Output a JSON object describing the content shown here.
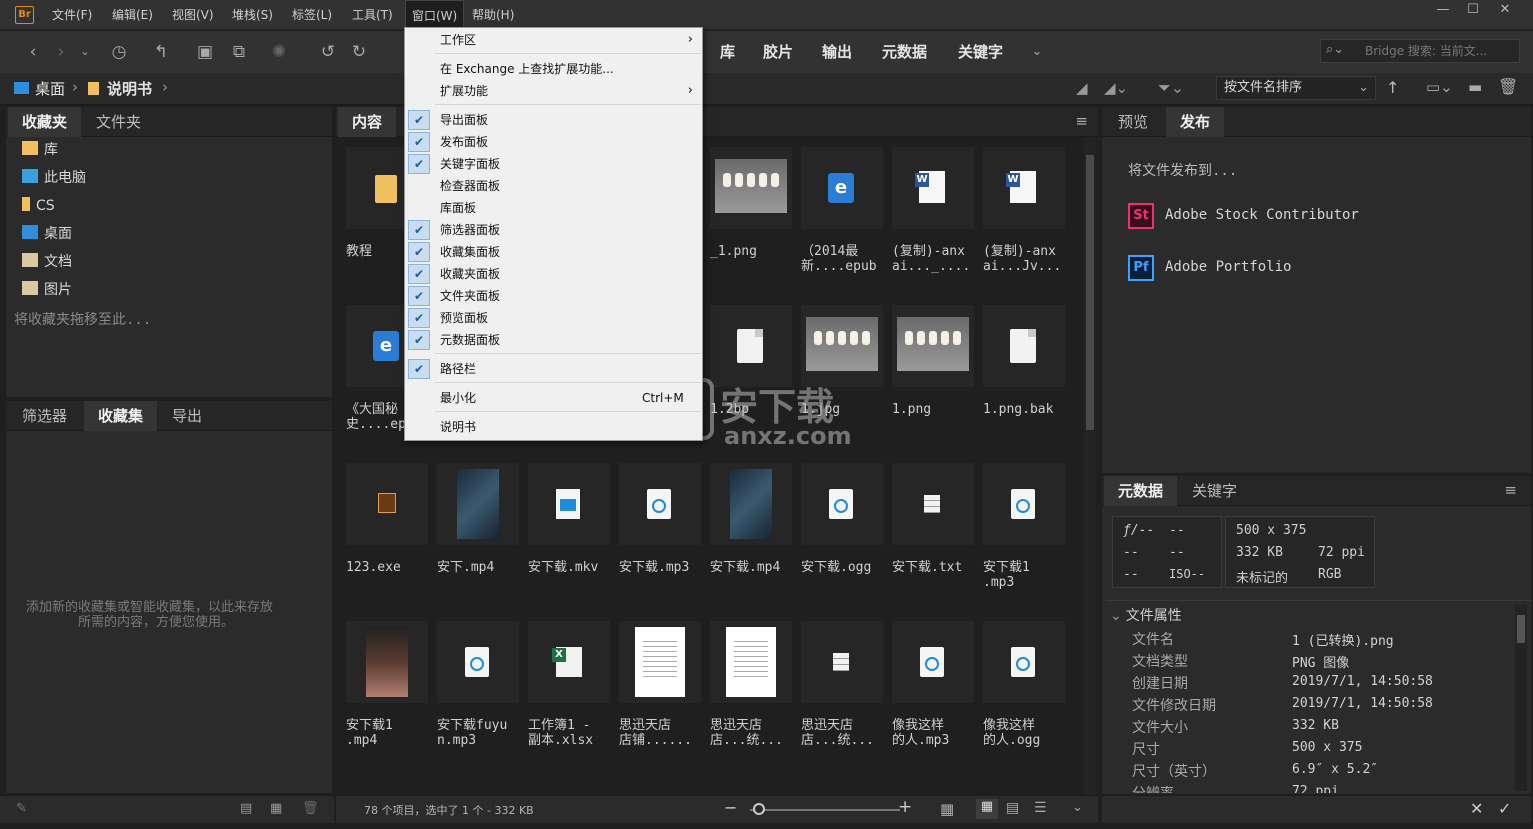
{
  "app": {
    "logo": "Br"
  },
  "menubar": {
    "items": [
      "文件(F)",
      "编辑(E)",
      "视图(V)",
      "堆栈(S)",
      "标签(L)",
      "工具(T)",
      "窗口(W)",
      "帮助(H)"
    ],
    "window_controls": [
      "—",
      "☐",
      "✕"
    ]
  },
  "workspaces": [
    "库",
    "胶片",
    "输出",
    "元数据",
    "关键字"
  ],
  "search": {
    "placeholder": "Bridge 搜索: 当前文..."
  },
  "breadcrumb": [
    "桌面",
    "说明书"
  ],
  "sort": {
    "label": "按文件名排序"
  },
  "left_top_panel": {
    "tabs": [
      "收藏夹",
      "文件夹"
    ],
    "items": [
      "库",
      "此电脑",
      "CS",
      "桌面",
      "文档",
      "图片"
    ],
    "hint": "将收藏夹拖移至此..."
  },
  "left_bottom_panel": {
    "tabs": [
      "筛选器",
      "收藏集",
      "导出"
    ],
    "hint_line1": "添加新的收藏集或智能收藏集，以此来存放",
    "hint_line2": "所需的内容，方便您使用。"
  },
  "content_panel": {
    "tab": "内容",
    "items": [
      {
        "label": "教程",
        "icon": "folder"
      },
      {
        "label": "",
        "icon": "hidden"
      },
      {
        "label": "",
        "icon": "hidden"
      },
      {
        "label": "",
        "icon": "hidden"
      },
      {
        "label": "_1.png",
        "icon": "dogs"
      },
      {
        "label": "（2014最\n新....epub",
        "icon": "edge"
      },
      {
        "label": "(复制)-anx\nai..._....",
        "icon": "word"
      },
      {
        "label": "(复制)-anx\nai...Jv...",
        "icon": "word"
      },
      {
        "label": "《大国秘\n史....ep",
        "icon": "edge"
      },
      {
        "label": "",
        "icon": "hidden"
      },
      {
        "label": "",
        "icon": "hidden"
      },
      {
        "label": "",
        "icon": "hidden"
      },
      {
        "label": "1.2bp",
        "icon": "doc"
      },
      {
        "label": "1.jpg",
        "icon": "dogs"
      },
      {
        "label": "1.png",
        "icon": "dogs"
      },
      {
        "label": "1.png.bak",
        "icon": "doc"
      },
      {
        "label": "123.exe",
        "icon": "exe"
      },
      {
        "label": "安下.mp4",
        "icon": "dark"
      },
      {
        "label": "安下载.mkv",
        "icon": "video"
      },
      {
        "label": "安下载.mp3",
        "icon": "media"
      },
      {
        "label": "安下载.mp4",
        "icon": "dark"
      },
      {
        "label": "安下载.ogg",
        "icon": "media"
      },
      {
        "label": "安下载.txt",
        "icon": "txt"
      },
      {
        "label": "安下载1\n.mp3",
        "icon": "media"
      },
      {
        "label": "安下载1\n.mp4",
        "icon": "portrait"
      },
      {
        "label": "安下载fuyu\nn.mp3",
        "icon": "media"
      },
      {
        "label": "工作簿1 -\n副本.xlsx",
        "icon": "xls"
      },
      {
        "label": "思迅天店\n店铺......",
        "icon": "page"
      },
      {
        "label": "思迅天店\n店...统...",
        "icon": "page"
      },
      {
        "label": "思迅天店\n店...统...",
        "icon": "txt"
      },
      {
        "label": "像我这样\n的人.mp3",
        "icon": "media"
      },
      {
        "label": "像我这样\n的人.ogg",
        "icon": "media"
      }
    ]
  },
  "status": {
    "text": "78 个项目，选中了 1 个 - 332 KB"
  },
  "right_top_panel": {
    "tabs": [
      "预览",
      "发布"
    ],
    "publish_title": "将文件发布到...",
    "targets": [
      {
        "badge": "St",
        "label": "Adobe Stock Contributor",
        "color": "#e8336b"
      },
      {
        "badge": "Pf",
        "label": "Adobe Portfolio",
        "color": "#3ea0ff"
      }
    ]
  },
  "metadata_panel": {
    "tabs": [
      "元数据",
      "关键字"
    ],
    "camera": {
      "f": "ƒ/--",
      "f2": "--",
      "a": "--",
      "b": "--",
      "c": "--",
      "iso": "ISO--"
    },
    "summary": {
      "dims": "500 x 375",
      "size": "332 KB",
      "ppi": "72 ppi",
      "label": "未标记的",
      "mode": "RGB"
    },
    "section": "文件属性",
    "props": [
      {
        "k": "文件名",
        "v": "1 (已转换).png"
      },
      {
        "k": "文档类型",
        "v": "PNG 图像"
      },
      {
        "k": "创建日期",
        "v": "2019/7/1, 14:50:58"
      },
      {
        "k": "文件修改日期",
        "v": "2019/7/1, 14:50:58"
      },
      {
        "k": "文件大小",
        "v": "332 KB"
      },
      {
        "k": "尺寸",
        "v": "500 x 375"
      },
      {
        "k": "尺寸（英寸）",
        "v": "6.9″ x 5.2″"
      },
      {
        "k": "分辨率",
        "v": "72 ppi"
      }
    ]
  },
  "window_menu": {
    "items": [
      {
        "label": "工作区",
        "check": false,
        "arrow": "›"
      },
      {
        "label": "在 Exchange 上查找扩展功能...",
        "check": false
      },
      {
        "label": "扩展功能",
        "check": false,
        "arrow": "›"
      },
      {
        "label": "导出面板",
        "check": true
      },
      {
        "label": "发布面板",
        "check": true
      },
      {
        "label": "关键字面板",
        "check": true
      },
      {
        "label": "检查器面板",
        "check": false
      },
      {
        "label": "库面板",
        "check": false
      },
      {
        "label": "筛选器面板",
        "check": true
      },
      {
        "label": "收藏集面板",
        "check": true
      },
      {
        "label": "收藏夹面板",
        "check": true
      },
      {
        "label": "文件夹面板",
        "check": true
      },
      {
        "label": "预览面板",
        "check": true
      },
      {
        "label": "元数据面板",
        "check": true
      },
      {
        "label": "路径栏",
        "check": true
      },
      {
        "label": "最小化",
        "check": false,
        "shortcut": "Ctrl+M"
      },
      {
        "label": "说明书",
        "check": false
      }
    ],
    "check_glyph": "✔"
  },
  "watermark": {
    "text": "安下载",
    "sub": "anxz.com"
  }
}
